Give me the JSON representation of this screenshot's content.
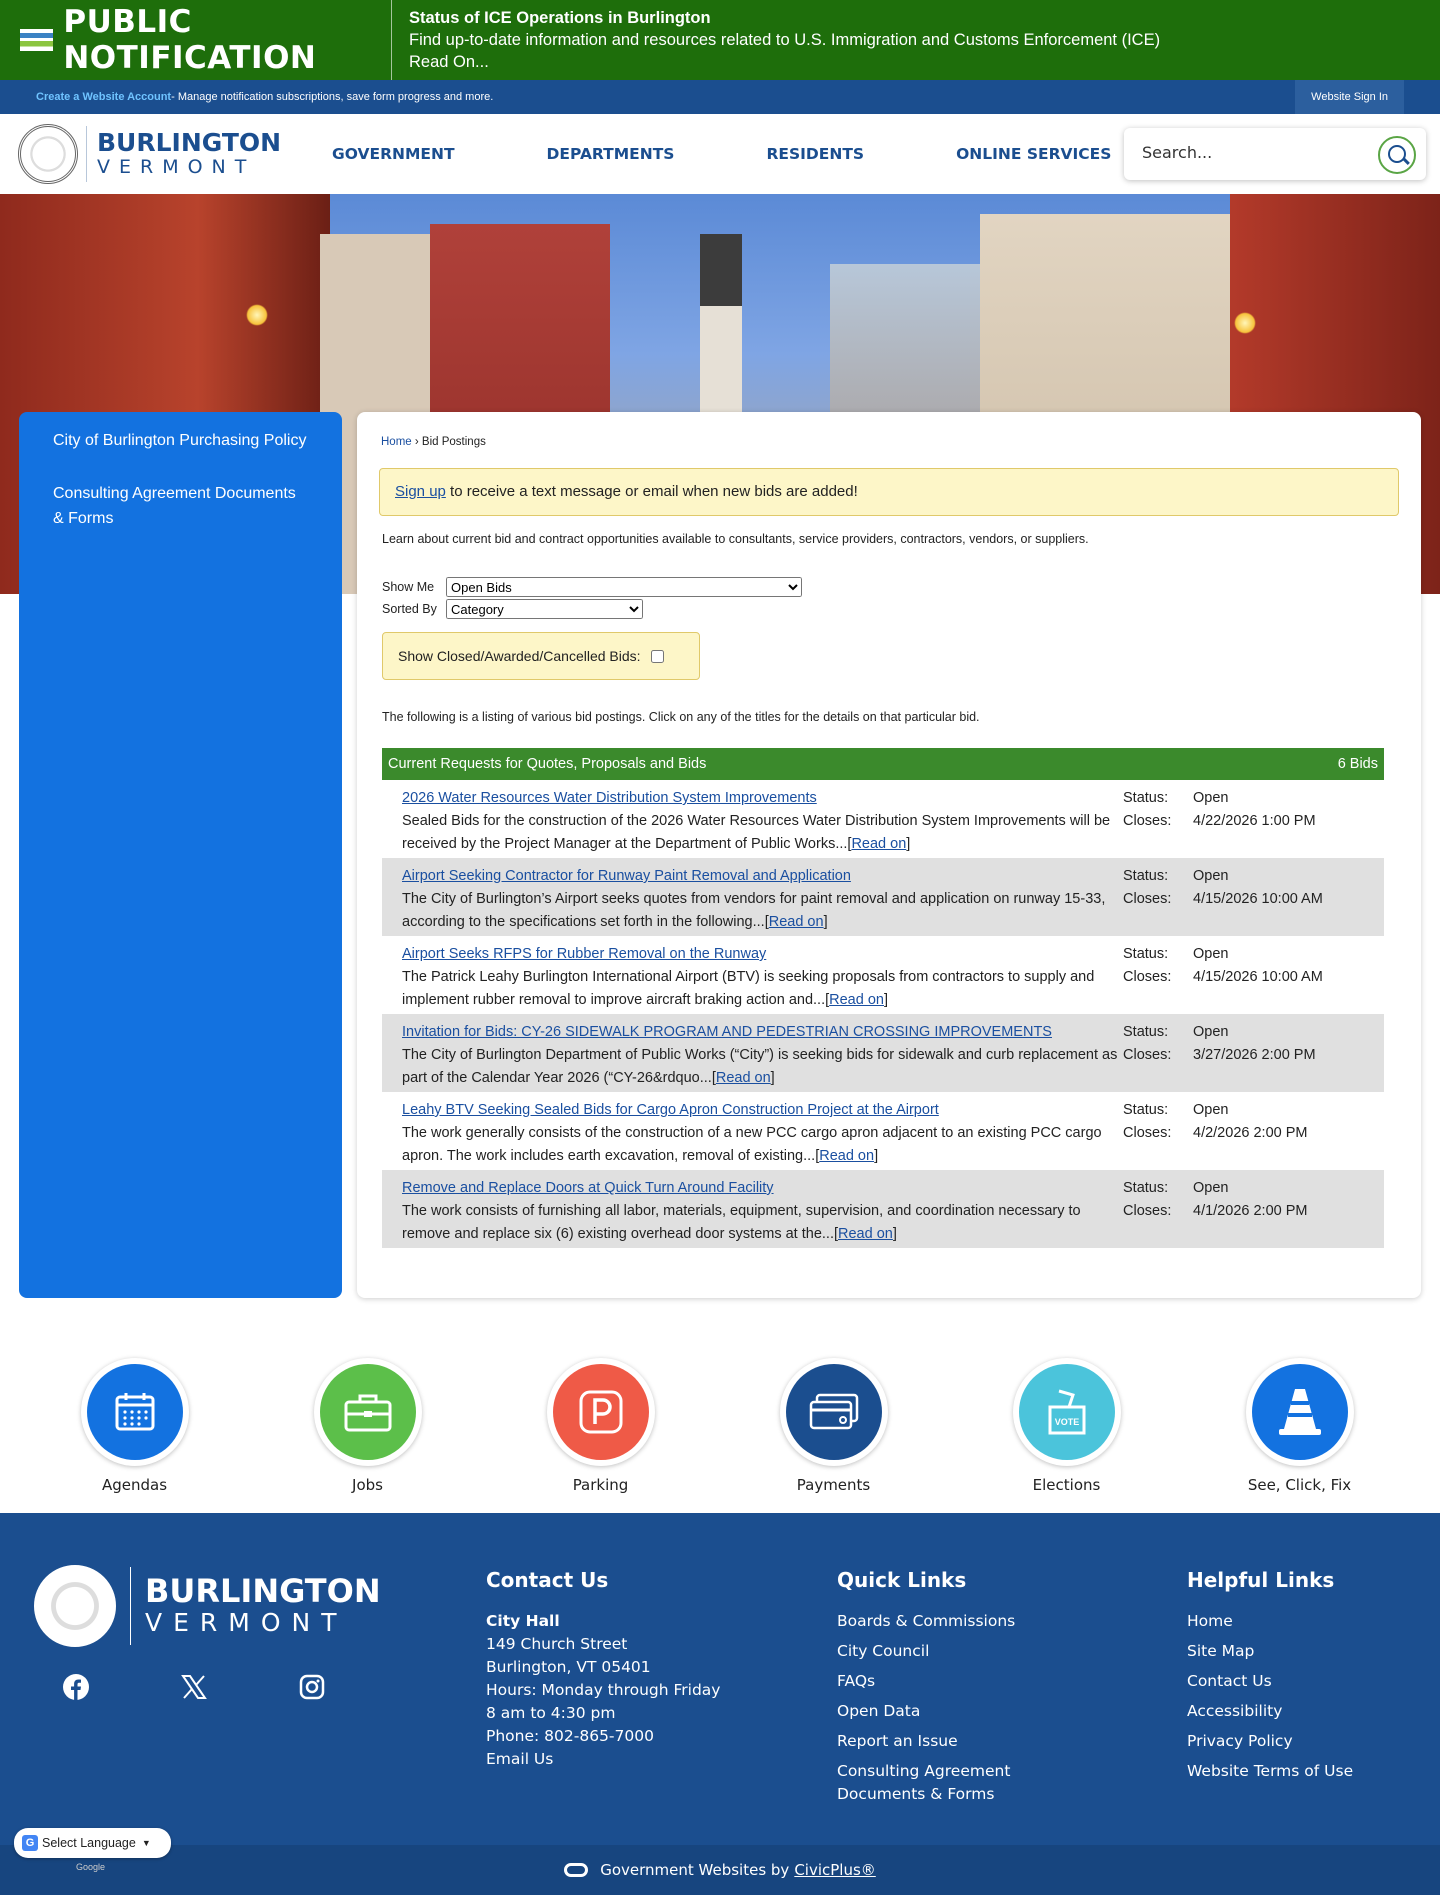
{
  "alert": {
    "badge": "PUBLIC NOTIFICATION",
    "title": "Status of ICE Operations in Burlington",
    "text": "Find up-to-date information and resources related to U.S. Immigration and Customs Enforcement (ICE)",
    "link": "Read On..."
  },
  "account": {
    "create_link": "Create a Website Account",
    "text": " - Manage notification subscriptions, save form progress and more.",
    "signin": "Website Sign In"
  },
  "header": {
    "logo_line1": "BURLINGTON",
    "logo_line2": "VERMONT",
    "nav": [
      "GOVERNMENT",
      "DEPARTMENTS",
      "RESIDENTS",
      "ONLINE SERVICES"
    ],
    "search_placeholder": "Search..."
  },
  "sidebar": {
    "items": [
      "City of Burlington Purchasing Policy",
      "Consulting Agreement Documents & Forms"
    ]
  },
  "main": {
    "breadcrumb_home": "Home",
    "breadcrumb_sep": " › ",
    "breadcrumb_current": "Bid Postings",
    "notice_link": "Sign up",
    "notice_text": " to receive a text message or email when new bids are added!",
    "intro": "Learn about current bid and contract opportunities available to consultants, service providers, contractors, vendors, or suppliers.",
    "show_me_label": "Show Me",
    "show_me_value": "Open Bids",
    "sorted_by_label": "Sorted By",
    "sorted_by_value": "Category",
    "closed_label": "Show Closed/Awarded/Cancelled Bids:",
    "listing_text": "The following is a listing of various bid postings. Click on any of the titles for the details on that particular bid.",
    "table_title": "Current Requests for Quotes, Proposals and Bids",
    "table_count": "6 Bids",
    "status_label": "Status:",
    "closes_label": "Closes:",
    "read_on": "Read on",
    "bids": [
      {
        "title": "2026 Water Resources Water Distribution System Improvements",
        "desc": "Sealed Bids for the construction of the 2026 Water Resources Water Distribution System Improvements will be received by the Project Manager at the Department of Public Works...",
        "status": "Open",
        "closes": "4/22/2026 1:00 PM"
      },
      {
        "title": "Airport Seeking Contractor for Runway Paint Removal and Application",
        "desc": "The City of Burlington’s Airport seeks quotes from vendors for paint removal and application on runway 15-33, according to the specifications set forth in the following...",
        "status": "Open",
        "closes": "4/15/2026 10:00 AM"
      },
      {
        "title": "Airport Seeks RFPS for Rubber Removal on the Runway",
        "desc": "The Patrick Leahy Burlington International Airport (BTV) is seeking proposals from contractors to supply and implement rubber removal to improve aircraft braking action and...",
        "status": "Open",
        "closes": "4/15/2026 10:00 AM"
      },
      {
        "title": "Invitation for Bids: CY-26 SIDEWALK PROGRAM AND PEDESTRIAN CROSSING IMPROVEMENTS",
        "desc": "The City of Burlington Department of Public Works (“City”) is seeking bids for sidewalk and curb replacement as part of the Calendar Year 2026 (“CY-26&rdquo...",
        "status": "Open",
        "closes": "3/27/2026 2:00 PM"
      },
      {
        "title": "Leahy BTV Seeking Sealed Bids for Cargo Apron Construction Project at the Airport",
        "desc": "The work generally consists of the construction of a new PCC cargo apron adjacent to an existing PCC cargo apron. The work includes earth excavation, removal of existing...",
        "status": "Open",
        "closes": "4/2/2026 2:00 PM"
      },
      {
        "title": "Remove and Replace Doors at Quick Turn Around Facility",
        "desc": "The work consists of furnishing all labor, materials, equipment, supervision, and coordination necessary to remove and replace six (6) existing overhead door systems at the...",
        "status": "Open",
        "closes": "4/1/2026 2:00 PM"
      }
    ]
  },
  "quick_links": [
    {
      "label": "Agendas",
      "icon": "calendar-icon",
      "color": "#1372e0"
    },
    {
      "label": "Jobs",
      "icon": "briefcase-icon",
      "color": "#5cbf4a"
    },
    {
      "label": "Parking",
      "icon": "parking-icon",
      "color": "#ef5a47"
    },
    {
      "label": "Payments",
      "icon": "credit-card-icon",
      "color": "#1b4e8f"
    },
    {
      "label": "Elections",
      "icon": "ballot-box-icon",
      "color": "#4bc4db"
    },
    {
      "label": "See, Click, Fix",
      "icon": "traffic-cone-icon",
      "color": "#1372e0"
    }
  ],
  "footer": {
    "logo_line1": "BURLINGTON",
    "logo_line2": "VERMONT",
    "contact_heading": "Contact Us",
    "contact_name": "City Hall",
    "contact_lines": [
      "149 Church Street",
      "Burlington, VT 05401",
      "Hours: Monday through Friday",
      "8 am to 4:30 pm",
      "Phone: 802-865-7000",
      "Email Us"
    ],
    "quick_heading": "Quick Links",
    "quick_links": [
      "Boards & Commissions",
      "City Council",
      "FAQs",
      "Open Data",
      "Report an Issue",
      "Consulting Agreement Documents & Forms"
    ],
    "helpful_heading": "Helpful Links",
    "helpful_links": [
      "Home",
      "Site Map",
      "Contact Us",
      "Accessibility",
      "Privacy Policy",
      "Website Terms of Use"
    ],
    "credit_text": "Government Websites by",
    "credit_link": "CivicPlus®",
    "translate": "Select Language",
    "powered": "Google"
  },
  "colors": {
    "alert_green": "#1e6e0b",
    "brand_blue": "#1b4e8f",
    "sidebar_blue": "#1372e0",
    "table_header_green": "#3b8a2c"
  }
}
